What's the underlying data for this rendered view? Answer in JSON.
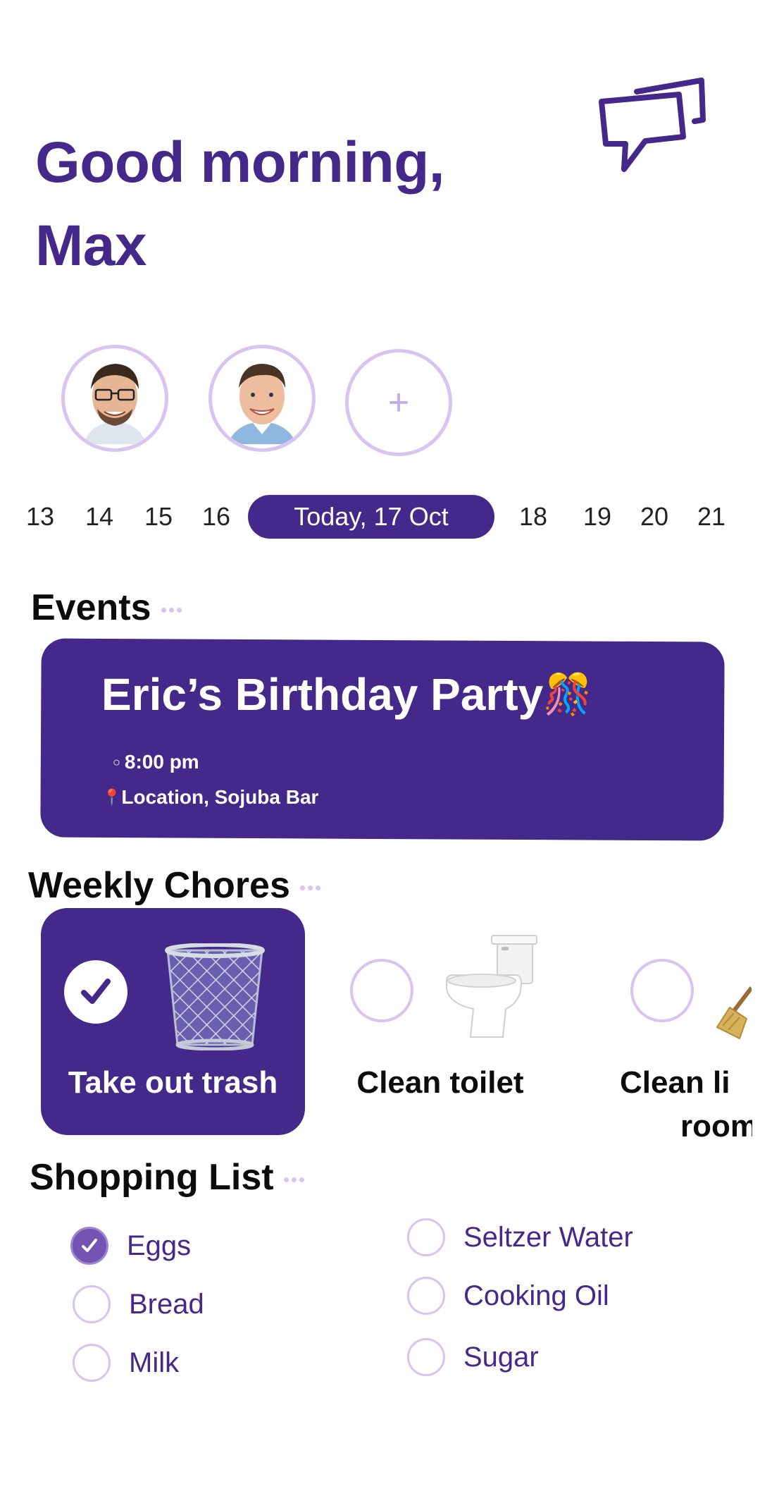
{
  "header": {
    "greeting_line1": "Good morning,",
    "greeting_line2": "Max",
    "chat_icon": "chat-bubbles-icon"
  },
  "members": [
    {
      "name": "member-1",
      "icon": "avatar-man-glasses"
    },
    {
      "name": "member-2",
      "icon": "avatar-man-smiling"
    }
  ],
  "add_member_label": "+",
  "dates": {
    "before": [
      "13",
      "14",
      "15",
      "16"
    ],
    "today": "Today, 17  Oct",
    "after": [
      "18",
      "19",
      "20",
      "21"
    ]
  },
  "events": {
    "title": "Events",
    "card": {
      "title": "Eric’s Birthday Party",
      "title_emoji": "🎊",
      "time_bullet": "○",
      "time": "8:00 pm",
      "location_pin": "📍",
      "location": "Location, Sojuba Bar"
    }
  },
  "chores": {
    "title": "Weekly Chores",
    "items": [
      {
        "label": "Take out trash",
        "done": true,
        "icon": "trash-basket-icon"
      },
      {
        "label": "Clean toilet",
        "done": false,
        "icon": "toilet-icon"
      },
      {
        "label_line1": "Clean li",
        "label_line2": "room",
        "done": false,
        "icon": "broom-icon"
      }
    ]
  },
  "shopping": {
    "title": "Shopping List",
    "left": [
      {
        "label": "Eggs",
        "checked": true
      },
      {
        "label": "Bread",
        "checked": false
      },
      {
        "label": "Milk",
        "checked": false
      }
    ],
    "right": [
      {
        "label": "Seltzer Water",
        "checked": false
      },
      {
        "label": "Cooking Oil",
        "checked": false
      },
      {
        "label": "Sugar",
        "checked": false
      }
    ]
  },
  "colors": {
    "primary": "#44298a",
    "accent_light": "#d9c3f0",
    "checked_fill": "#7254b3",
    "background": "#ffffff"
  }
}
